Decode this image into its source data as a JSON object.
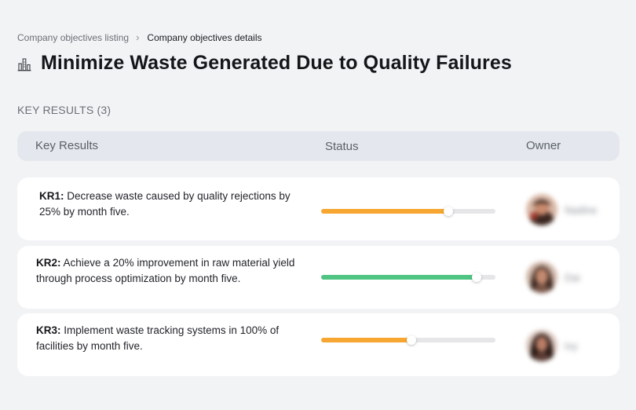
{
  "breadcrumb": {
    "parent": "Company objectives listing",
    "separator": "›",
    "current": "Company objectives details"
  },
  "objective": {
    "icon": "building-chart-icon",
    "title": "Minimize Waste Generated Due to Quality Failures"
  },
  "key_results_label": "KEY RESULTS (3)",
  "table": {
    "headers": {
      "key_results": "Key Results",
      "status": "Status",
      "owner": "Owner"
    },
    "rows": [
      {
        "id": "KR1:",
        "text": "Decrease waste caused by quality rejections by 25% by month five.",
        "progress": 0.73,
        "color": "#f7a731",
        "owner": "Nadine"
      },
      {
        "id": "KR2:",
        "text": "Achieve a 20% improvement in raw material yield through process optimization by month five.",
        "progress": 0.89,
        "color": "#4fc483",
        "owner": "Dai"
      },
      {
        "id": "KR3:",
        "text": "Implement waste tracking systems in 100% of facilities by month five.",
        "progress": 0.52,
        "color": "#f7a731",
        "owner": "Ivy"
      }
    ]
  }
}
